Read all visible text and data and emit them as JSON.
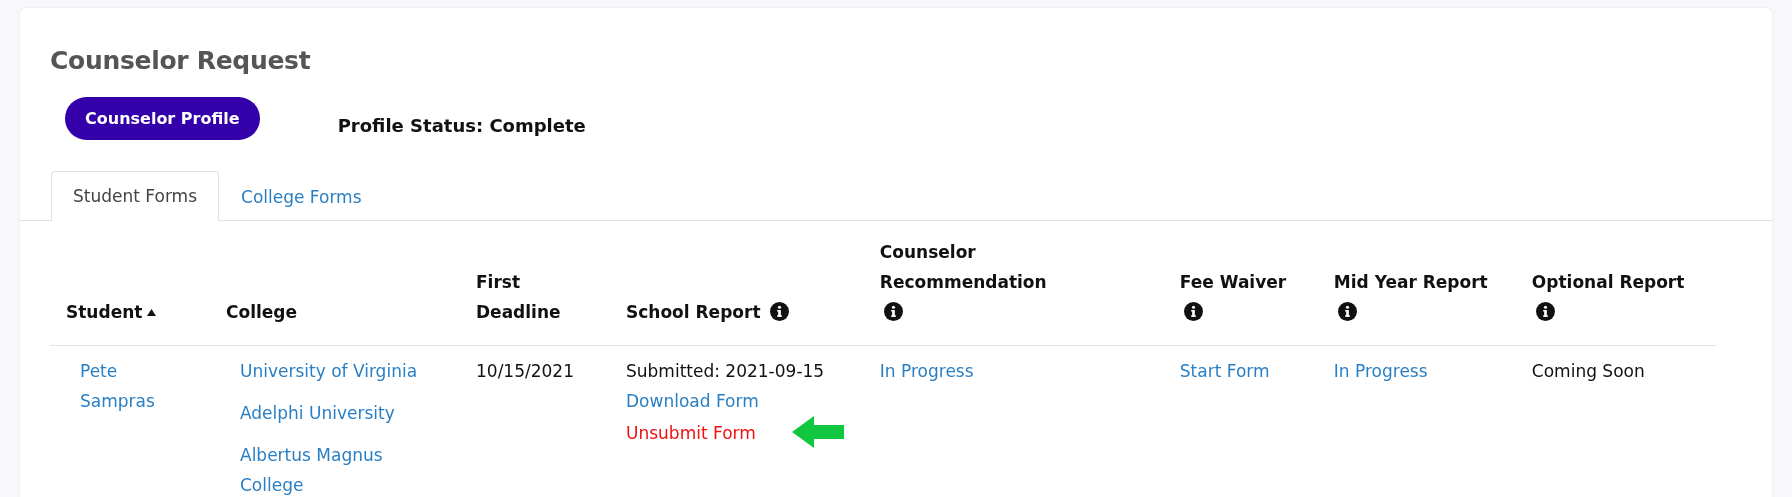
{
  "title": "Counselor Request",
  "profile_button": "Counselor Profile",
  "profile_status": "Profile Status: Complete",
  "tabs": [
    {
      "label": "Student Forms",
      "selected": true
    },
    {
      "label": "College Forms",
      "selected": false
    }
  ],
  "table": {
    "columns": [
      {
        "label": "Student",
        "sorted": true,
        "info": false
      },
      {
        "label": "College",
        "sorted": false,
        "info": false
      },
      {
        "label": "First Deadline",
        "sorted": false,
        "info": false
      },
      {
        "label": "School Report",
        "sorted": false,
        "info": true
      },
      {
        "label": "Counselor Recommendation",
        "sorted": false,
        "info": true
      },
      {
        "label": "Fee Waiver",
        "sorted": false,
        "info": true
      },
      {
        "label": "Mid Year Report",
        "sorted": false,
        "info": true
      },
      {
        "label": "Optional Report",
        "sorted": false,
        "info": true
      }
    ],
    "rows": [
      {
        "cells": [
          [
            {
              "text": "Pete Sampras",
              "kind": "link"
            }
          ],
          [
            {
              "text": "University of Virginia",
              "kind": "link"
            },
            {
              "text": "Adelphi University",
              "kind": "link"
            },
            {
              "text": "Albertus Magnus College",
              "kind": "link"
            }
          ],
          [
            {
              "text": "10/15/2021",
              "kind": "text"
            }
          ],
          [
            {
              "text": "Submitted: 2021-09-15",
              "kind": "text"
            },
            {
              "text": "Download Form",
              "kind": "link"
            },
            {
              "text": "Unsubmit Form",
              "kind": "danger",
              "pointer": true
            }
          ],
          [
            {
              "text": "In Progress",
              "kind": "link"
            }
          ],
          [
            {
              "text": "Start Form",
              "kind": "link"
            }
          ],
          [
            {
              "text": "In Progress",
              "kind": "link"
            }
          ],
          [
            {
              "text": "Coming Soon",
              "kind": "text"
            }
          ]
        ]
      }
    ]
  }
}
